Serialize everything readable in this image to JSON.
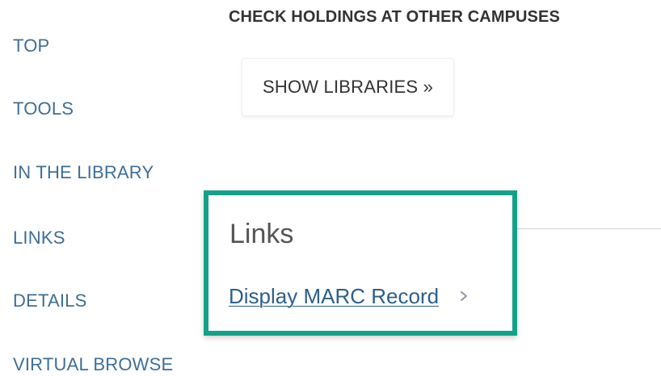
{
  "nav": {
    "items": [
      {
        "label": "TOP"
      },
      {
        "label": "TOOLS"
      },
      {
        "label": "IN THE LIBRARY"
      },
      {
        "label": "LINKS"
      },
      {
        "label": "DETAILS"
      },
      {
        "label": "VIRTUAL BROWSE"
      }
    ]
  },
  "holdings": {
    "heading": "CHECK HOLDINGS AT OTHER CAMPUSES",
    "button_label": "SHOW LIBRARIES »"
  },
  "links_section": {
    "heading": "Links",
    "marc_link_label": "Display MARC Record",
    "chevron_icon": "chevron-right-icon"
  },
  "colors": {
    "nav_link": "#3f6e96",
    "highlight_border": "#13a289",
    "link": "#2d5f8b"
  }
}
